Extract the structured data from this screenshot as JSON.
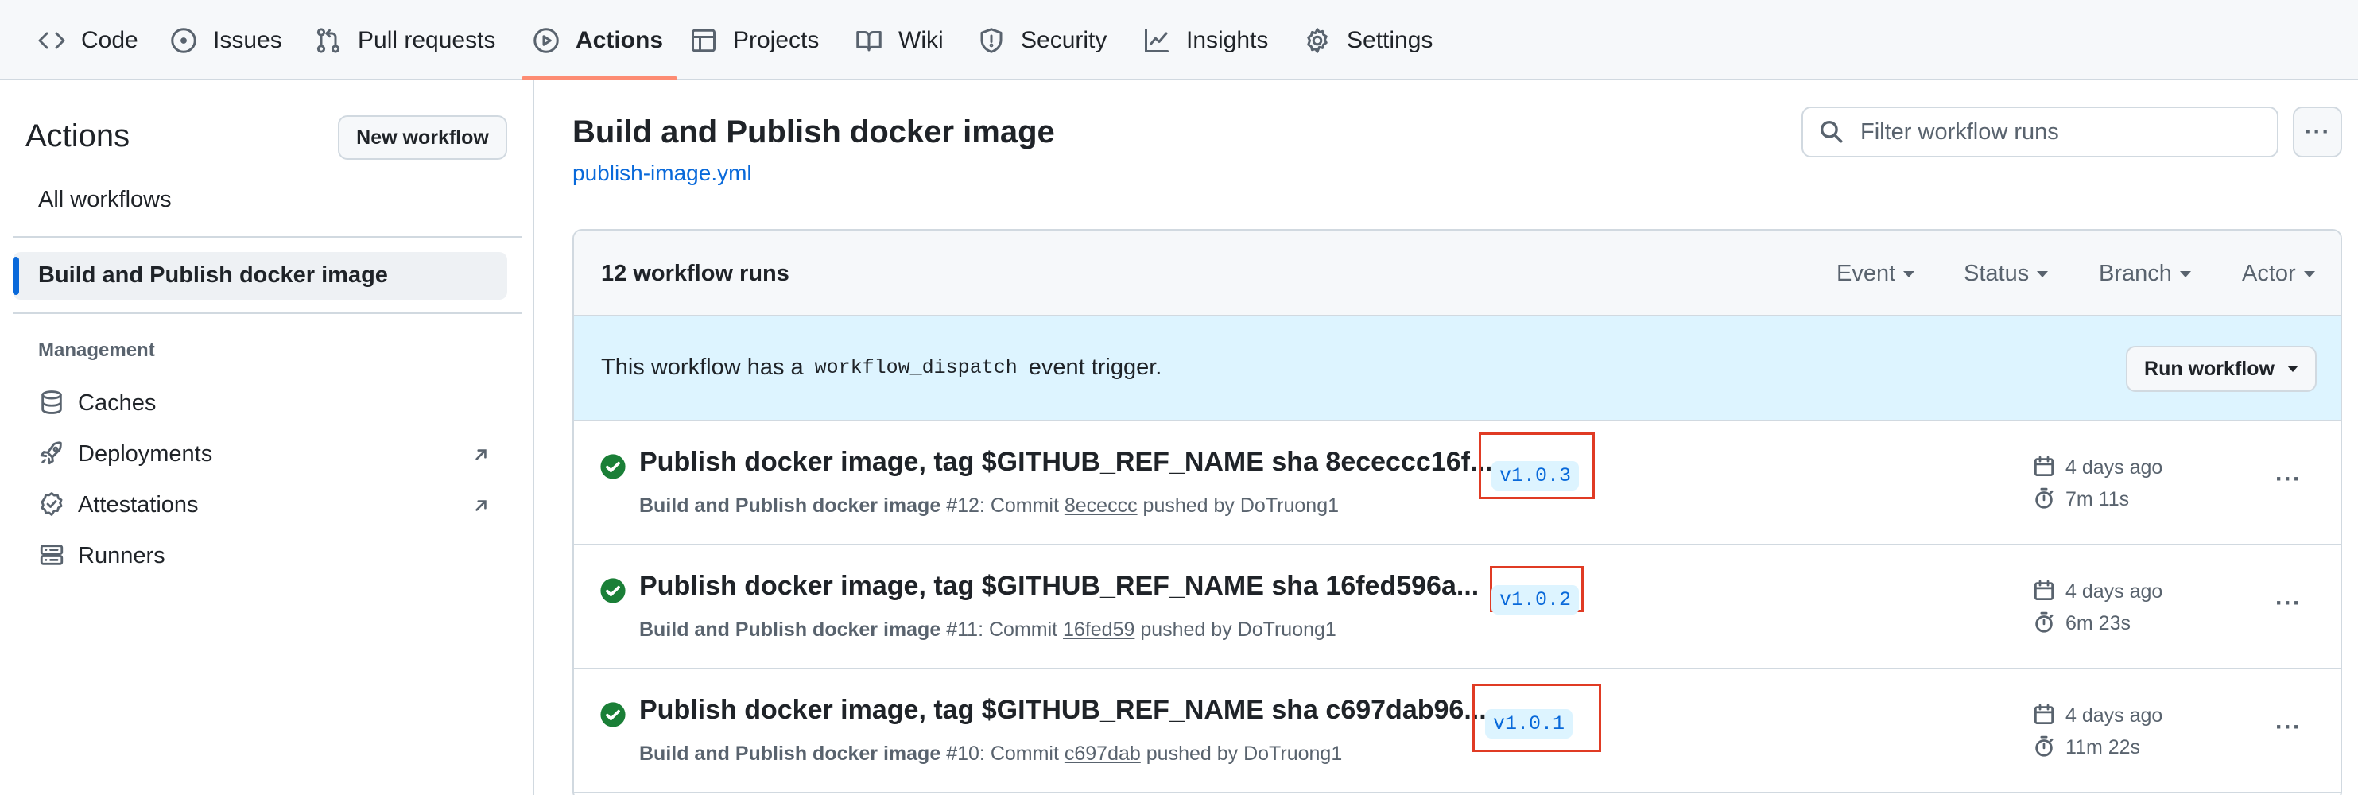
{
  "repo_nav": {
    "tabs": [
      {
        "label": "Code",
        "icon": "code-icon"
      },
      {
        "label": "Issues",
        "icon": "issue-opened-icon"
      },
      {
        "label": "Pull requests",
        "icon": "git-pull-request-icon"
      },
      {
        "label": "Actions",
        "icon": "play-icon",
        "selected": true
      },
      {
        "label": "Projects",
        "icon": "table-icon"
      },
      {
        "label": "Wiki",
        "icon": "book-icon"
      },
      {
        "label": "Security",
        "icon": "shield-icon"
      },
      {
        "label": "Insights",
        "icon": "graph-icon"
      },
      {
        "label": "Settings",
        "icon": "gear-icon"
      }
    ]
  },
  "sidebar": {
    "title": "Actions",
    "new_workflow_label": "New workflow",
    "all_workflows_label": "All workflows",
    "selected_workflow": "Build and Publish docker image",
    "management_heading": "Management",
    "management_items": [
      {
        "label": "Caches",
        "icon": "database-icon",
        "external": false
      },
      {
        "label": "Deployments",
        "icon": "rocket-icon",
        "external": true
      },
      {
        "label": "Attestations",
        "icon": "verified-icon",
        "external": true
      },
      {
        "label": "Runners",
        "icon": "server-icon",
        "external": false
      }
    ]
  },
  "main": {
    "workflow_title": "Build and Publish docker image",
    "workflow_file": "publish-image.yml",
    "filter_placeholder": "Filter workflow runs",
    "more_label": "···",
    "runs_count": "12 workflow runs",
    "filters": [
      "Event",
      "Status",
      "Branch",
      "Actor"
    ],
    "dispatch": {
      "prefix": "This workflow has a",
      "code": "workflow_dispatch",
      "suffix": "event trigger.",
      "run_workflow_label": "Run workflow"
    },
    "runs": [
      {
        "title": "Publish docker image, tag $GITHUB_REF_NAME sha 8ececcc16f...",
        "workflow": "Build and Publish docker image",
        "number": "#12",
        "commit_prefix": ": Commit",
        "sha": "8ececcc",
        "pushed_by": "pushed by DoTruong1",
        "tag": "v1.0.3",
        "when": "4 days ago",
        "duration": "7m 11s",
        "status": "success"
      },
      {
        "title": "Publish docker image, tag $GITHUB_REF_NAME sha 16fed596a...",
        "workflow": "Build and Publish docker image",
        "number": "#11",
        "commit_prefix": ": Commit",
        "sha": "16fed59",
        "pushed_by": "pushed by DoTruong1",
        "tag": "v1.0.2",
        "when": "4 days ago",
        "duration": "6m 23s",
        "status": "success"
      },
      {
        "title": "Publish docker image, tag $GITHUB_REF_NAME sha c697dab96...",
        "workflow": "Build and Publish docker image",
        "number": "#10",
        "commit_prefix": ": Commit",
        "sha": "c697dab",
        "pushed_by": "pushed by DoTruong1",
        "tag": "v1.0.1",
        "when": "4 days ago",
        "duration": "11m 22s",
        "status": "success"
      }
    ]
  },
  "colors": {
    "accent_link": "#0969da",
    "selected_tab_underline": "#fd8c73",
    "success": "#1a7f37",
    "highlight_box": "#e03b24",
    "dispatch_bg": "#ddf4ff"
  }
}
